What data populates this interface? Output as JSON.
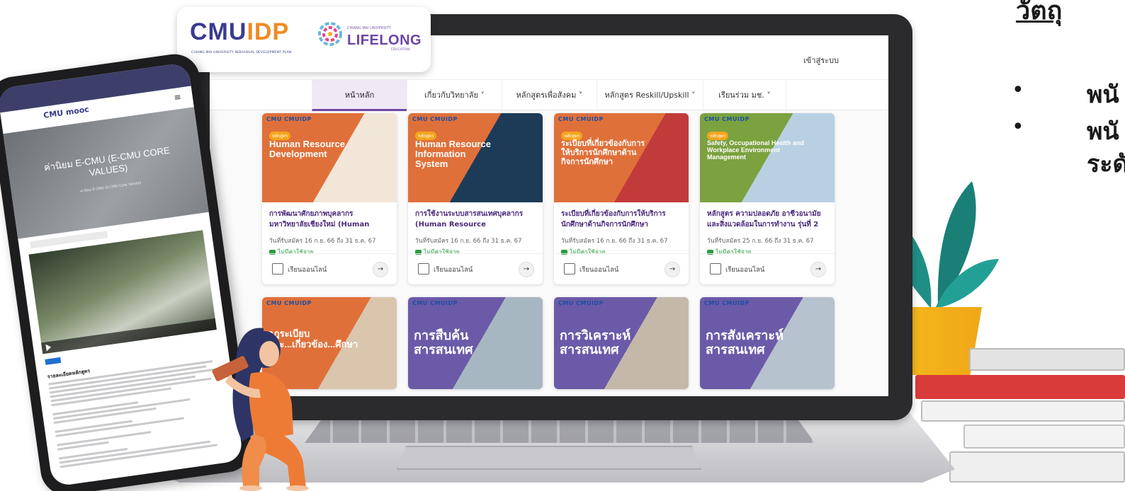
{
  "logo": {
    "cmuidp_main": "CMUIDP",
    "cmuidp_sub": "CHIANG MAI UNIVERSITY INDIVIDUAL DEVELOPMENT PLAN",
    "lifelong_top": "CHIANG MAI UNIVERSITY",
    "lifelong_main": "LIFELONG",
    "lifelong_bottom": "EDUCATION"
  },
  "site": {
    "login_label": "เข้าสู่ระบบ",
    "nav": [
      {
        "label": "หน้าหลัก"
      },
      {
        "label": "เกี่ยวกับวิทยาลัย ˅"
      },
      {
        "label": "หลักสูตรเพื่อสังคม ˅"
      },
      {
        "label": "หลักสูตร Reskill/Upskill ˅"
      },
      {
        "label": "เรียนร่วม มช. ˅"
      }
    ],
    "cards_row1": [
      {
        "logos": "CMU  CMUIDP",
        "tag": "หลักสูตร",
        "img_title": "Human Resource Development",
        "title": "การพัฒนาศักยภาพบุคลากรมหาวิทยาลัยเชียงใหม่ (Human Resource...",
        "date": "วันที่รับสมัคร 16 ก.ย. 66 ถึง 31 ธ.ค. 67",
        "price": "ไม่มีค่าใช้จ่าย",
        "mode": "เรียนออนไลน์",
        "color": "#e07c3c"
      },
      {
        "logos": "CMU  CMUIDP",
        "tag": "หลักสูตร",
        "img_title": "Human Resource Information System",
        "title": "การใช้งานระบบสารสนเทศบุคลากร (Human Resource Information...",
        "date": "วันที่รับสมัคร 16 ก.ย. 66 ถึง 31 ธ.ค. 67",
        "price": "ไม่มีค่าใช้จ่าย",
        "mode": "เรียนออนไลน์",
        "color": "#e07c3c"
      },
      {
        "logos": "CMU  CMUIDP",
        "tag": "หลักสูตร",
        "img_title": "ระเบียบที่เกี่ยวข้องกับการให้บริการนักศึกษาด้านกิจการนักศึกษา",
        "title": "ระเบียบที่เกี่ยวข้องกับการให้บริการนักศึกษาด้านกิจการนักศึกษา",
        "date": "วันที่รับสมัคร 16 ก.ย. 66 ถึง 31 ธ.ค. 67",
        "price": "ไม่มีค่าใช้จ่าย",
        "mode": "เรียนออนไลน์",
        "color": "#e07c3c"
      },
      {
        "logos": "CMU  CMUIDP",
        "tag": "หลักสูตร",
        "img_title": "Safety, Occupational Health and Workplace Environment Management",
        "title": "หลักสูตร ความปลอดภัย อาชีวอนามัย และสิ่งแวดล้อมในการทำงาน รุ่นที่ 2",
        "date": "วันที่รับสมัคร 25 ก.ย. 66 ถึง 31 ธ.ค. 67",
        "price": "ไม่มีค่าใช้จ่าย",
        "mode": "เรียนออนไลน์",
        "color": "#7ba23f"
      }
    ],
    "cards_row2": [
      {
        "logos": "CMU  CMUIDP",
        "img_title": "กฎระเบียบและ...เกี่ยวข้อง...ศึกษา",
        "color": "#e07c3c"
      },
      {
        "logos": "CMU  CMUIDP",
        "img_title": "การสืบค้นสารสนเทศ",
        "color": "#6b5aa8"
      },
      {
        "logos": "CMU  CMUIDP",
        "img_title": "การวิเคราะห์สารสนเทศ",
        "color": "#6b5aa8"
      },
      {
        "logos": "CMU  CMUIDP",
        "img_title": "การสังเคราะห์สารสนเทศ",
        "color": "#6b5aa8"
      }
    ]
  },
  "phone": {
    "mooc_label": "CMU mooc",
    "menu_icon": "≡",
    "hero_title": "ค่านิยม E-CMU (E-CMU CORE VALUES)",
    "hero_sub": "ค่านิยม E-CMU (E-CMU Core Values)",
    "section_heading": "รายละเอียดหลักสูตร"
  },
  "right": {
    "top_text": "วัตถุ",
    "bullet": "•",
    "line1": "พนั",
    "line2": "พนั",
    "line3": "ระดั"
  },
  "colors": {
    "brand_purple": "#6b44a5",
    "brand_orange": "#f08a24",
    "card_title": "#4a2a7a",
    "free_green": "#2a9c3f"
  }
}
